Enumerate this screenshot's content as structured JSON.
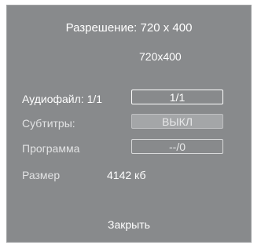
{
  "info": {
    "title": "Разрешение: 720 x 400",
    "resolution_value": "720x400"
  },
  "rows": {
    "audio": {
      "label": "Аудиофайл: 1/1",
      "value": "1/1"
    },
    "subtitles": {
      "label": "Субтитры:",
      "value": "ВЫКЛ"
    },
    "program": {
      "label": "Программа",
      "value": "--/0"
    },
    "size": {
      "label": "Размер",
      "value": "4142 кб"
    }
  },
  "actions": {
    "close_label": "Закрыть"
  }
}
